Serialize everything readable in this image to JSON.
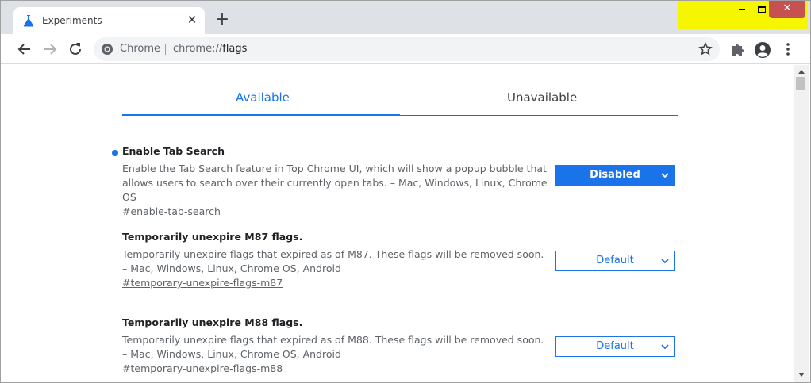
{
  "browser": {
    "tab": {
      "title": "Experiments",
      "icon": "flask-icon",
      "close_glyph": "✕"
    },
    "new_tab_glyph": "+",
    "window_controls": {
      "minimize": "minimize-icon",
      "maximize": "maximize-icon",
      "close_glyph": "✕",
      "highlight_color": "#f6f600"
    },
    "omnibox": {
      "site_label": "Chrome",
      "url_scheme": "chrome://",
      "url_path": "flags"
    }
  },
  "page": {
    "tabs": [
      {
        "label": "Available",
        "active": true
      },
      {
        "label": "Unavailable",
        "active": false
      }
    ],
    "flags": [
      {
        "name": "Enable Tab Search",
        "description": "Enable the Tab Search feature in Top Chrome UI, which will show a popup bubble that allows users to search over their currently open tabs. – Mac, Windows, Linux, Chrome OS",
        "link": "#enable-tab-search",
        "value": "Disabled",
        "modified": true
      },
      {
        "name": "Temporarily unexpire M87 flags.",
        "description": "Temporarily unexpire flags that expired as of M87. These flags will be removed soon. – Mac, Windows, Linux, Chrome OS, Android",
        "link": "#temporary-unexpire-flags-m87",
        "value": "Default",
        "modified": false
      },
      {
        "name": "Temporarily unexpire M88 flags.",
        "description": "Temporarily unexpire flags that expired as of M88. These flags will be removed soon. – Mac, Windows, Linux, Chrome OS, Android",
        "link": "#temporary-unexpire-flags-m88",
        "value": "Default",
        "modified": false
      }
    ]
  },
  "colors": {
    "accent": "#1a73e8",
    "tabstrip": "#dee1e6",
    "close_button": "#c75050"
  }
}
